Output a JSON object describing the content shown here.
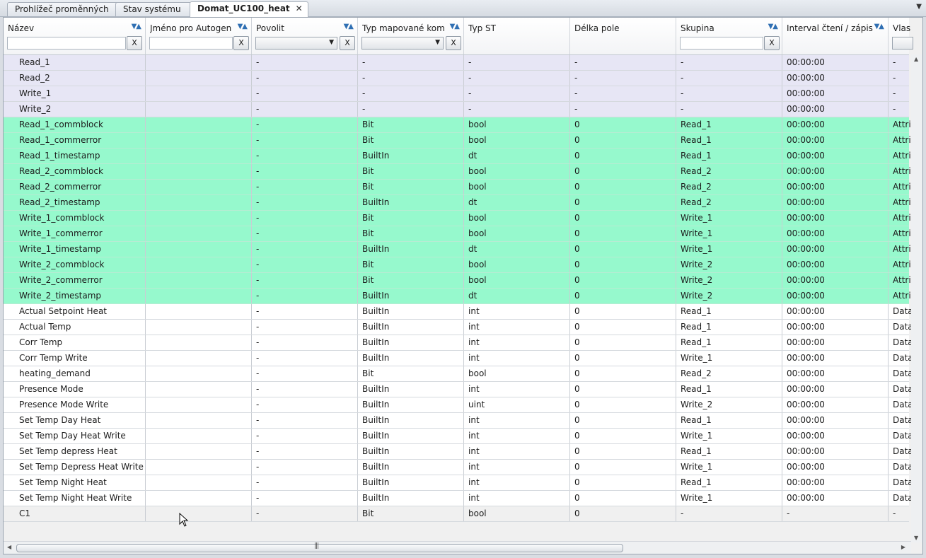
{
  "tabs": [
    {
      "label": "Prohlížeč proměnných"
    },
    {
      "label": "Stav systému"
    },
    {
      "label": "Domat_UC100_heat",
      "active": true
    }
  ],
  "columns": [
    {
      "label": "Název",
      "sortable": true,
      "filter": "text"
    },
    {
      "label": "Jméno pro Autogen",
      "sortable": true,
      "filter": "text"
    },
    {
      "label": "Povolit",
      "sortable": true,
      "filter": "select"
    },
    {
      "label": "Typ mapované kom. h",
      "sortable": true,
      "filter": "select"
    },
    {
      "label": "Typ ST",
      "sortable": false,
      "filter": "none"
    },
    {
      "label": "Délka pole",
      "sortable": false,
      "filter": "none"
    },
    {
      "label": "Skupina",
      "sortable": true,
      "filter": "text"
    },
    {
      "label": "Interval čtení / zápis",
      "sortable": true,
      "filter": "none"
    },
    {
      "label": "Vlas",
      "sortable": false,
      "filter": "button"
    }
  ],
  "filter_clear_label": "X",
  "rows": [
    {
      "group": "var",
      "cells": [
        "Read_1",
        "",
        "-",
        "-",
        "-",
        "-",
        "-",
        "00:00:00",
        "-"
      ]
    },
    {
      "group": "var",
      "cells": [
        "Read_2",
        "",
        "-",
        "-",
        "-",
        "-",
        "-",
        "00:00:00",
        "-"
      ]
    },
    {
      "group": "var",
      "cells": [
        "Write_1",
        "",
        "-",
        "-",
        "-",
        "-",
        "-",
        "00:00:00",
        "-"
      ]
    },
    {
      "group": "var",
      "cells": [
        "Write_2",
        "",
        "-",
        "-",
        "-",
        "-",
        "-",
        "00:00:00",
        "-"
      ]
    },
    {
      "group": "attr",
      "cells": [
        "Read_1_commblock",
        "",
        "-",
        "Bit",
        "bool",
        "0",
        "Read_1",
        "00:00:00",
        "Attri"
      ]
    },
    {
      "group": "attr",
      "cells": [
        "Read_1_commerror",
        "",
        "-",
        "Bit",
        "bool",
        "0",
        "Read_1",
        "00:00:00",
        "Attri"
      ]
    },
    {
      "group": "attr",
      "cells": [
        "Read_1_timestamp",
        "",
        "-",
        "BuiltIn",
        "dt",
        "0",
        "Read_1",
        "00:00:00",
        "Attri"
      ]
    },
    {
      "group": "attr",
      "cells": [
        "Read_2_commblock",
        "",
        "-",
        "Bit",
        "bool",
        "0",
        "Read_2",
        "00:00:00",
        "Attri"
      ]
    },
    {
      "group": "attr",
      "cells": [
        "Read_2_commerror",
        "",
        "-",
        "Bit",
        "bool",
        "0",
        "Read_2",
        "00:00:00",
        "Attri"
      ]
    },
    {
      "group": "attr",
      "cells": [
        "Read_2_timestamp",
        "",
        "-",
        "BuiltIn",
        "dt",
        "0",
        "Read_2",
        "00:00:00",
        "Attri"
      ]
    },
    {
      "group": "attr",
      "cells": [
        "Write_1_commblock",
        "",
        "-",
        "Bit",
        "bool",
        "0",
        "Write_1",
        "00:00:00",
        "Attri"
      ]
    },
    {
      "group": "attr",
      "cells": [
        "Write_1_commerror",
        "",
        "-",
        "Bit",
        "bool",
        "0",
        "Write_1",
        "00:00:00",
        "Attri"
      ]
    },
    {
      "group": "attr",
      "cells": [
        "Write_1_timestamp",
        "",
        "-",
        "BuiltIn",
        "dt",
        "0",
        "Write_1",
        "00:00:00",
        "Attri"
      ]
    },
    {
      "group": "attr",
      "cells": [
        "Write_2_commblock",
        "",
        "-",
        "Bit",
        "bool",
        "0",
        "Write_2",
        "00:00:00",
        "Attri"
      ]
    },
    {
      "group": "attr",
      "cells": [
        "Write_2_commerror",
        "",
        "-",
        "Bit",
        "bool",
        "0",
        "Write_2",
        "00:00:00",
        "Attri"
      ]
    },
    {
      "group": "attr",
      "cells": [
        "Write_2_timestamp",
        "",
        "-",
        "BuiltIn",
        "dt",
        "0",
        "Write_2",
        "00:00:00",
        "Attri"
      ]
    },
    {
      "group": "data",
      "cells": [
        "Actual Setpoint Heat",
        "",
        "-",
        "BuiltIn",
        "int",
        "0",
        "Read_1",
        "00:00:00",
        "Data"
      ]
    },
    {
      "group": "data",
      "cells": [
        "Actual Temp",
        "",
        "-",
        "BuiltIn",
        "int",
        "0",
        "Read_1",
        "00:00:00",
        "Data"
      ]
    },
    {
      "group": "data",
      "cells": [
        "Corr Temp",
        "",
        "-",
        "BuiltIn",
        "int",
        "0",
        "Read_1",
        "00:00:00",
        "Data"
      ]
    },
    {
      "group": "data",
      "cells": [
        "Corr Temp Write",
        "",
        "-",
        "BuiltIn",
        "int",
        "0",
        "Write_1",
        "00:00:00",
        "Data"
      ]
    },
    {
      "group": "data",
      "cells": [
        "heating_demand",
        "",
        "-",
        "Bit",
        "bool",
        "0",
        "Read_2",
        "00:00:00",
        "Data"
      ]
    },
    {
      "group": "data",
      "cells": [
        "Presence Mode",
        "",
        "-",
        "BuiltIn",
        "int",
        "0",
        "Read_1",
        "00:00:00",
        "Data"
      ]
    },
    {
      "group": "data",
      "cells": [
        "Presence Mode Write",
        "",
        "-",
        "BuiltIn",
        "uint",
        "0",
        "Write_2",
        "00:00:00",
        "Data"
      ]
    },
    {
      "group": "data",
      "cells": [
        "Set Temp Day Heat",
        "",
        "-",
        "BuiltIn",
        "int",
        "0",
        "Read_1",
        "00:00:00",
        "Data"
      ]
    },
    {
      "group": "data",
      "cells": [
        "Set Temp Day Heat Write",
        "",
        "-",
        "BuiltIn",
        "int",
        "0",
        "Write_1",
        "00:00:00",
        "Data"
      ]
    },
    {
      "group": "data",
      "cells": [
        "Set Temp depress Heat",
        "",
        "-",
        "BuiltIn",
        "int",
        "0",
        "Read_1",
        "00:00:00",
        "Data"
      ]
    },
    {
      "group": "data",
      "cells": [
        "Set Temp Depress Heat Write",
        "",
        "-",
        "BuiltIn",
        "int",
        "0",
        "Write_1",
        "00:00:00",
        "Data"
      ]
    },
    {
      "group": "data",
      "cells": [
        "Set Temp Night Heat",
        "",
        "-",
        "BuiltIn",
        "int",
        "0",
        "Read_1",
        "00:00:00",
        "Data"
      ]
    },
    {
      "group": "data",
      "cells": [
        "Set Temp Night Heat Write",
        "",
        "-",
        "BuiltIn",
        "int",
        "0",
        "Write_1",
        "00:00:00",
        "Data"
      ]
    },
    {
      "group": "sel",
      "cells": [
        "C1",
        "",
        "-",
        "Bit",
        "bool",
        "0",
        "-",
        "-",
        "-"
      ]
    }
  ],
  "colors": {
    "var_row": "#e7e6f5",
    "attr_row": "#96f9cd",
    "data_row": "#ffffff",
    "selected_row": "#3494ee",
    "sort_icon": "#2f6fb3"
  },
  "icons": {
    "sort": "sort-arrows-icon",
    "dropdown": "dropdown-arrow-icon",
    "close_tab": "close-icon",
    "tab_menu": "chevron-down-icon",
    "scroll_grip": "grip-icon"
  }
}
